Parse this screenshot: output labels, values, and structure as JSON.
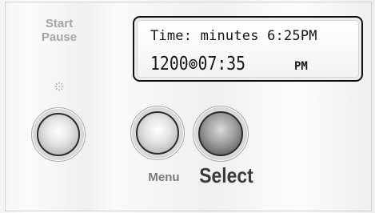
{
  "controls": {
    "start_pause_top": "Start",
    "start_pause_bottom": "Pause",
    "menu_label": "Menu",
    "select_label": "Select"
  },
  "display": {
    "line1": "Time: minutes 6:25PM",
    "line2_digits": "1200⊚07:35",
    "line2_ampm": "PM"
  },
  "icons": {
    "indicator": "status-light-icon"
  }
}
